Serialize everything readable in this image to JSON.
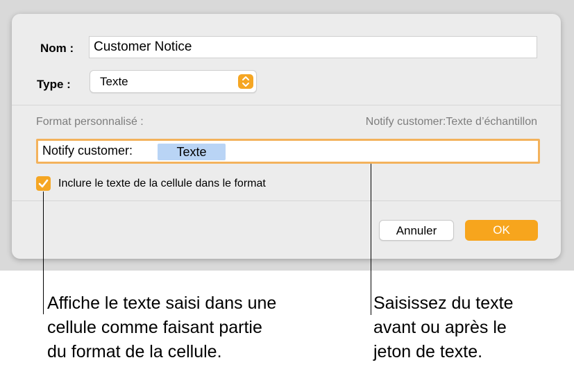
{
  "dialog": {
    "name_label": "Nom :",
    "name_value": "Customer Notice",
    "type_label": "Type :",
    "type_value": "Texte",
    "format_label": "Format personnalisé :",
    "sample_text": "Notify customer:Texte d’échantillon",
    "format_prefix": "Notify customer:",
    "token_label": "Texte",
    "checkbox_label": "Inclure le texte de la cellule dans le format",
    "checkbox_checked": true,
    "cancel_label": "Annuler",
    "ok_label": "OK",
    "accent_color": "#f5a623"
  },
  "callouts": {
    "left": [
      "Affiche le texte saisi dans une",
      "cellule comme faisant partie",
      "du format de la cellule."
    ],
    "right": [
      "Saisissez du texte",
      "avant ou après le",
      "jeton de texte."
    ]
  }
}
